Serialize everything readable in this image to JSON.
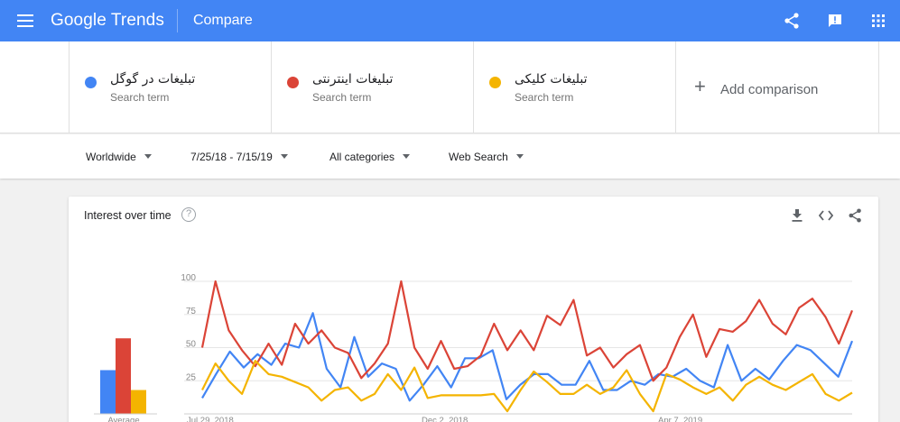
{
  "appbar": {
    "logo_google": "Google",
    "logo_trends": "Trends",
    "title": "Compare",
    "bg": "#4285f4"
  },
  "terms": [
    {
      "name": "تبلیغات در گوگل",
      "sub": "Search term",
      "color": "#4285f4"
    },
    {
      "name": "تبلیغات اینترنتی",
      "sub": "Search term",
      "color": "#db4437"
    },
    {
      "name": "تبلیغات کلیکی",
      "sub": "Search term",
      "color": "#f4b400"
    }
  ],
  "add_comparison": "Add comparison",
  "filters": {
    "region": "Worldwide",
    "date_range": "7/25/18 - 7/15/19",
    "category": "All categories",
    "search_type": "Web Search"
  },
  "card": {
    "title": "Interest over time",
    "help_glyph": "?"
  },
  "icons": {
    "menu": "menu-icon",
    "share": "share-icon",
    "feedback": "feedback-icon",
    "apps": "apps-icon",
    "download": "download-icon",
    "embed": "embed-icon",
    "card_share": "share-icon"
  },
  "chart_data": {
    "type": "line",
    "x_ticks": [
      "Jul 29, 2018",
      "Dec 2, 2018",
      "Apr 7, 2019"
    ],
    "ylim": [
      0,
      100
    ],
    "y_ticks": [
      25,
      50,
      75,
      100
    ],
    "grid": true,
    "average_label": "Average",
    "averages": [
      {
        "name": "تبلیغات در گوگل",
        "value": 33,
        "color": "#4285f4"
      },
      {
        "name": "تبلیغات اینترنتی",
        "value": 57,
        "color": "#db4437"
      },
      {
        "name": "تبلیغات کلیکی",
        "value": 18,
        "color": "#f4b400"
      }
    ],
    "series": [
      {
        "name": "تبلیغات در گوگل",
        "color": "#4285f4",
        "values": [
          12,
          30,
          47,
          35,
          45,
          37,
          53,
          50,
          76,
          34,
          20,
          58,
          28,
          38,
          34,
          10,
          22,
          36,
          20,
          42,
          42,
          48,
          11,
          22,
          30,
          30,
          22,
          22,
          40,
          18,
          18,
          25,
          22,
          30,
          28,
          34,
          25,
          20,
          52,
          25,
          34,
          26,
          40,
          52,
          48,
          38,
          28,
          55
        ]
      },
      {
        "name": "تبلیغات اینترنتی",
        "color": "#db4437",
        "values": [
          50,
          100,
          63,
          48,
          36,
          53,
          37,
          68,
          53,
          63,
          50,
          46,
          27,
          38,
          53,
          100,
          50,
          34,
          55,
          34,
          36,
          44,
          68,
          48,
          63,
          48,
          74,
          67,
          86,
          44,
          50,
          35,
          45,
          52,
          25,
          35,
          58,
          75,
          43,
          64,
          62,
          70,
          86,
          68,
          60,
          80,
          87,
          73,
          53,
          78
        ]
      },
      {
        "name": "تبلیغات کلیکی",
        "color": "#f4b400",
        "values": [
          18,
          38,
          25,
          15,
          40,
          30,
          28,
          24,
          20,
          10,
          18,
          20,
          10,
          15,
          30,
          18,
          35,
          12,
          14,
          14,
          14,
          14,
          15,
          2,
          18,
          32,
          24,
          15,
          15,
          22,
          15,
          20,
          33,
          15,
          2,
          30,
          26,
          20,
          15,
          20,
          10,
          22,
          28,
          22,
          18,
          24,
          30,
          15,
          10,
          16
        ]
      }
    ]
  }
}
